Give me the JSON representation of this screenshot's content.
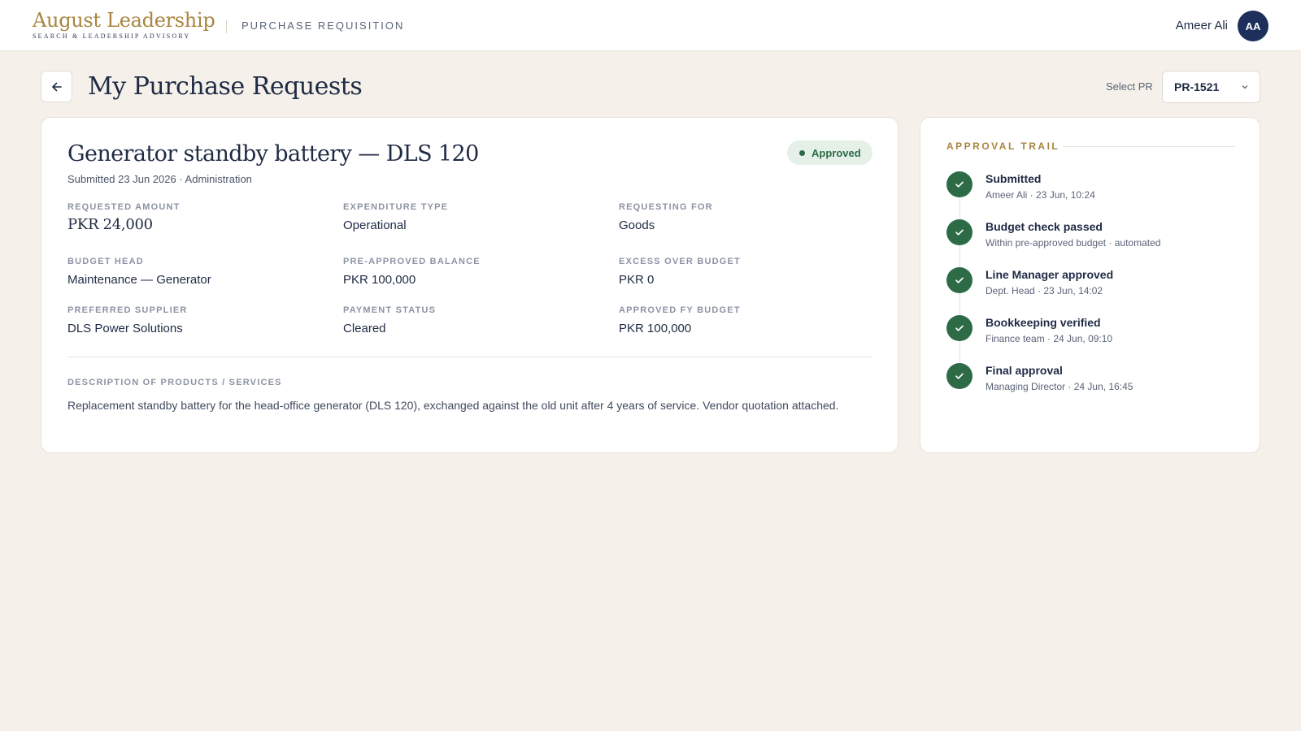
{
  "header": {
    "brand_name": "August Leadership",
    "brand_tagline": "SEARCH & LEADERSHIP ADVISORY",
    "module_title": "PURCHASE REQUISITION",
    "user_name": "Ameer Ali",
    "user_initials": "AA"
  },
  "page": {
    "title": "My Purchase Requests",
    "select_label": "Select PR",
    "selected_pr": "PR-1521"
  },
  "request": {
    "title": "Generator standby battery — DLS 120",
    "subtitle": "Submitted 23 Jun 2026 · Administration",
    "status": "Approved",
    "fields": [
      {
        "label": "REQUESTED AMOUNT",
        "value": "PKR 24,000"
      },
      {
        "label": "EXPENDITURE TYPE",
        "value": "Operational"
      },
      {
        "label": "REQUESTING FOR",
        "value": "Goods"
      },
      {
        "label": "BUDGET HEAD",
        "value": "Maintenance — Generator"
      },
      {
        "label": "PRE-APPROVED BALANCE",
        "value": "PKR 100,000"
      },
      {
        "label": "EXCESS OVER BUDGET",
        "value": "PKR 0"
      },
      {
        "label": "PREFERRED SUPPLIER",
        "value": "DLS Power Solutions"
      },
      {
        "label": "PAYMENT STATUS",
        "value": "Cleared"
      },
      {
        "label": "APPROVED FY BUDGET",
        "value": "PKR 100,000"
      }
    ],
    "description_label": "DESCRIPTION OF PRODUCTS / SERVICES",
    "description": "Replacement standby battery for the head-office generator (DLS 120), exchanged against the old unit after 4 years of service. Vendor quotation attached."
  },
  "approval_trail": {
    "title": "APPROVAL TRAIL",
    "steps": [
      {
        "title": "Submitted",
        "meta": "Ameer Ali · 23 Jun, 10:24"
      },
      {
        "title": "Budget check passed",
        "meta": "Within pre-approved budget · automated"
      },
      {
        "title": "Line Manager approved",
        "meta": "Dept. Head · 23 Jun, 14:02"
      },
      {
        "title": "Bookkeeping verified",
        "meta": "Finance team · 24 Jun, 09:10"
      },
      {
        "title": "Final approval",
        "meta": "Managing Director · 24 Jun, 16:45"
      }
    ]
  },
  "colors": {
    "accent_gold": "#a9853f",
    "navy": "#1f2f5c",
    "success_green": "#2d6b47",
    "background": "#f5f1ea"
  },
  "icons": {
    "back": "arrow-left-icon",
    "select": "chevron-down-icon",
    "step": "check-icon"
  }
}
